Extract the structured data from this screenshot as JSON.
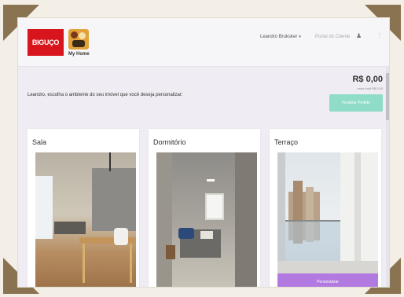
{
  "header": {
    "brand_logo_text": "BIGUÇO",
    "myhome_label": "My Home",
    "user_menu": "Leandro Bruksker",
    "portal_link": "Portal do Cliente",
    "user_icon": "user-icon",
    "more_icon": "more-icon"
  },
  "summary": {
    "price": "R$ 0,00",
    "price_sub": "valor total R$ 0,00",
    "finish_button": "Finalizar Pedido"
  },
  "prompt": "Leandro, escolha o ambiente do seu imóvel que você deseja personalizar:",
  "rooms": [
    {
      "title": "Sala"
    },
    {
      "title": "Dormitório"
    },
    {
      "title": "Terraço",
      "action": "Personalizar"
    }
  ],
  "colors": {
    "brand_red": "#d8141c",
    "finish_green": "#8fdcc8",
    "personalize_purple": "#b27ae0",
    "frame_brown": "#8a7350"
  }
}
